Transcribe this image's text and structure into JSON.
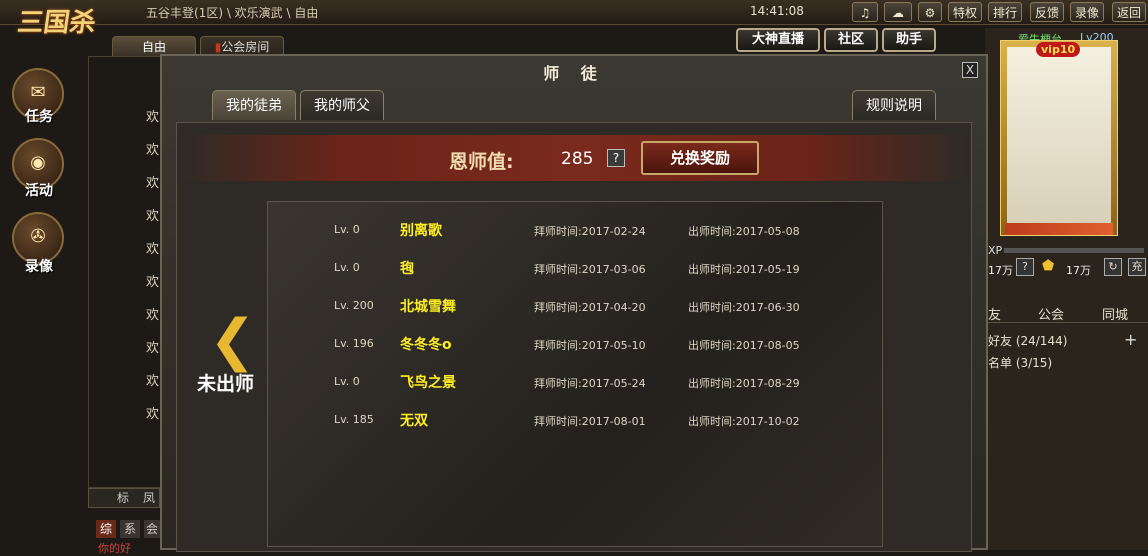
{
  "topbar": {
    "logo": "三国杀",
    "breadcrumb": "五谷丰登(1区) \\ 欢乐演武 \\ 自由",
    "clock": "14:41:08",
    "icons": [
      "music-icon",
      "chat-icon",
      "gear-icon"
    ],
    "buttons": [
      "特权",
      "排行",
      "反馈",
      "录像",
      "返回"
    ]
  },
  "top_actions": [
    "大神直播",
    "社区",
    "助手"
  ],
  "left_tabs": [
    "自由",
    "公会房间"
  ],
  "sidebar": [
    {
      "label": "任务",
      "icon": "scroll-icon"
    },
    {
      "label": "活动",
      "icon": "drum-icon"
    },
    {
      "label": "录像",
      "icon": "film-icon"
    }
  ],
  "chat_lines": [
    "欢",
    "欢",
    "欢",
    "欢",
    "欢",
    "欢",
    "欢",
    "欢",
    "欢",
    "欢"
  ],
  "chat_bottom": {
    "tabs": [
      "标",
      "凤"
    ],
    "channels": [
      "综",
      "系",
      "会"
    ],
    "last_msg": "你的好"
  },
  "dialog": {
    "title": "师 徒",
    "close": "X",
    "tabs": [
      "我的徒弟",
      "我的师父"
    ],
    "rules": "规则说明",
    "merit_label": "恩师值:",
    "merit_value": "285",
    "help": "?",
    "redeem": "兑换奖励",
    "side_label": "未出师",
    "rows": [
      {
        "level": "Lv. 0",
        "name": "别离歌",
        "join": "拜师时间:2017-02-24",
        "grad": "出师时间:2017-05-08"
      },
      {
        "level": "Lv. 0",
        "name": "毥",
        "join": "拜师时间:2017-03-06",
        "grad": "出师时间:2017-05-19"
      },
      {
        "level": "Lv. 200",
        "name": "北城雪舞",
        "join": "拜师时间:2017-04-20",
        "grad": "出师时间:2017-06-30"
      },
      {
        "level": "Lv. 196",
        "name": "冬冬冬o",
        "join": "拜师时间:2017-05-10",
        "grad": "出师时间:2017-08-05"
      },
      {
        "level": "Lv. 0",
        "name": "飞鸟之景",
        "join": "拜师时间:2017-05-24",
        "grad": "出师时间:2017-08-29"
      },
      {
        "level": "Lv. 185",
        "name": "无双",
        "join": "拜师时间:2017-08-01",
        "grad": "出师时间:2017-10-02"
      }
    ]
  },
  "right_panel": {
    "username": "爱失梗台",
    "level": "Lv200",
    "vip": "vip10",
    "xp": "XP",
    "currency1": "17万",
    "currency2": "17万",
    "charge": "充",
    "tabs": [
      "友",
      "公会",
      "同城"
    ],
    "friends": "好友 (24/144)",
    "blacklist": "名单 (3/15)",
    "add": "+"
  }
}
